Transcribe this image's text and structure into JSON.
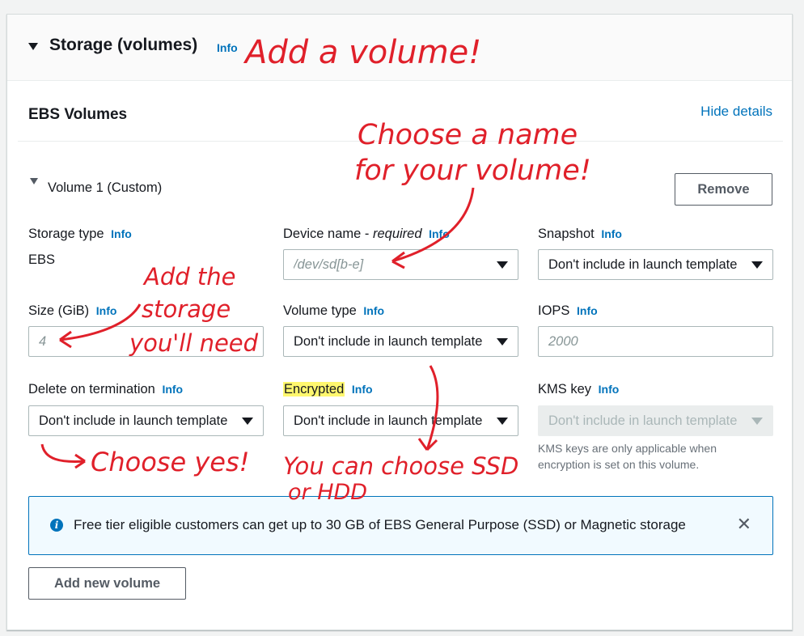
{
  "header": {
    "title": "Storage (volumes)",
    "info": "Info"
  },
  "section": {
    "title": "EBS Volumes",
    "hide_details": "Hide details"
  },
  "volume": {
    "title": "Volume 1 (Custom)",
    "remove": "Remove"
  },
  "fields": {
    "storage_type": {
      "label": "Storage type",
      "info": "Info",
      "value": "EBS"
    },
    "device_name": {
      "label": "Device name - ",
      "label_em": "required",
      "info": "Info",
      "placeholder": "/dev/sd[b-e]"
    },
    "snapshot": {
      "label": "Snapshot",
      "info": "Info",
      "value": "Don't include in launch template"
    },
    "size": {
      "label": "Size (GiB)",
      "info": "Info",
      "placeholder": "4"
    },
    "volume_type": {
      "label": "Volume type",
      "info": "Info",
      "value": "Don't include in launch template"
    },
    "iops": {
      "label": "IOPS",
      "info": "Info",
      "placeholder": "2000"
    },
    "delete_on_termination": {
      "label": "Delete on termination",
      "info": "Info",
      "value": "Don't include in launch template"
    },
    "encrypted": {
      "label": "Encrypted",
      "info": "Info",
      "value": "Don't include in launch template"
    },
    "kms_key": {
      "label": "KMS key",
      "info": "Info",
      "value": "Don't include in launch template",
      "note": "KMS keys are only applicable when encryption is set on this volume."
    }
  },
  "alert": {
    "text": "Free tier eligible customers can get up to 30 GB of EBS General Purpose (SSD) or Magnetic storage",
    "close": "✕"
  },
  "add_volume": "Add new volume",
  "annotations": {
    "add_volume": "Add a volume!",
    "choose_name_1": "Choose a name",
    "choose_name_2": "for your volume!",
    "add_storage_1": "Add the",
    "add_storage_2": "storage",
    "add_storage_3": "you'll need",
    "choose_yes": "Choose yes!",
    "ssd_hdd_1": "You can choose SSD",
    "ssd_hdd_2": "or HDD"
  },
  "colors": {
    "link": "#0073bb",
    "annotation": "#e0202a",
    "highlight": "#fff76e"
  }
}
